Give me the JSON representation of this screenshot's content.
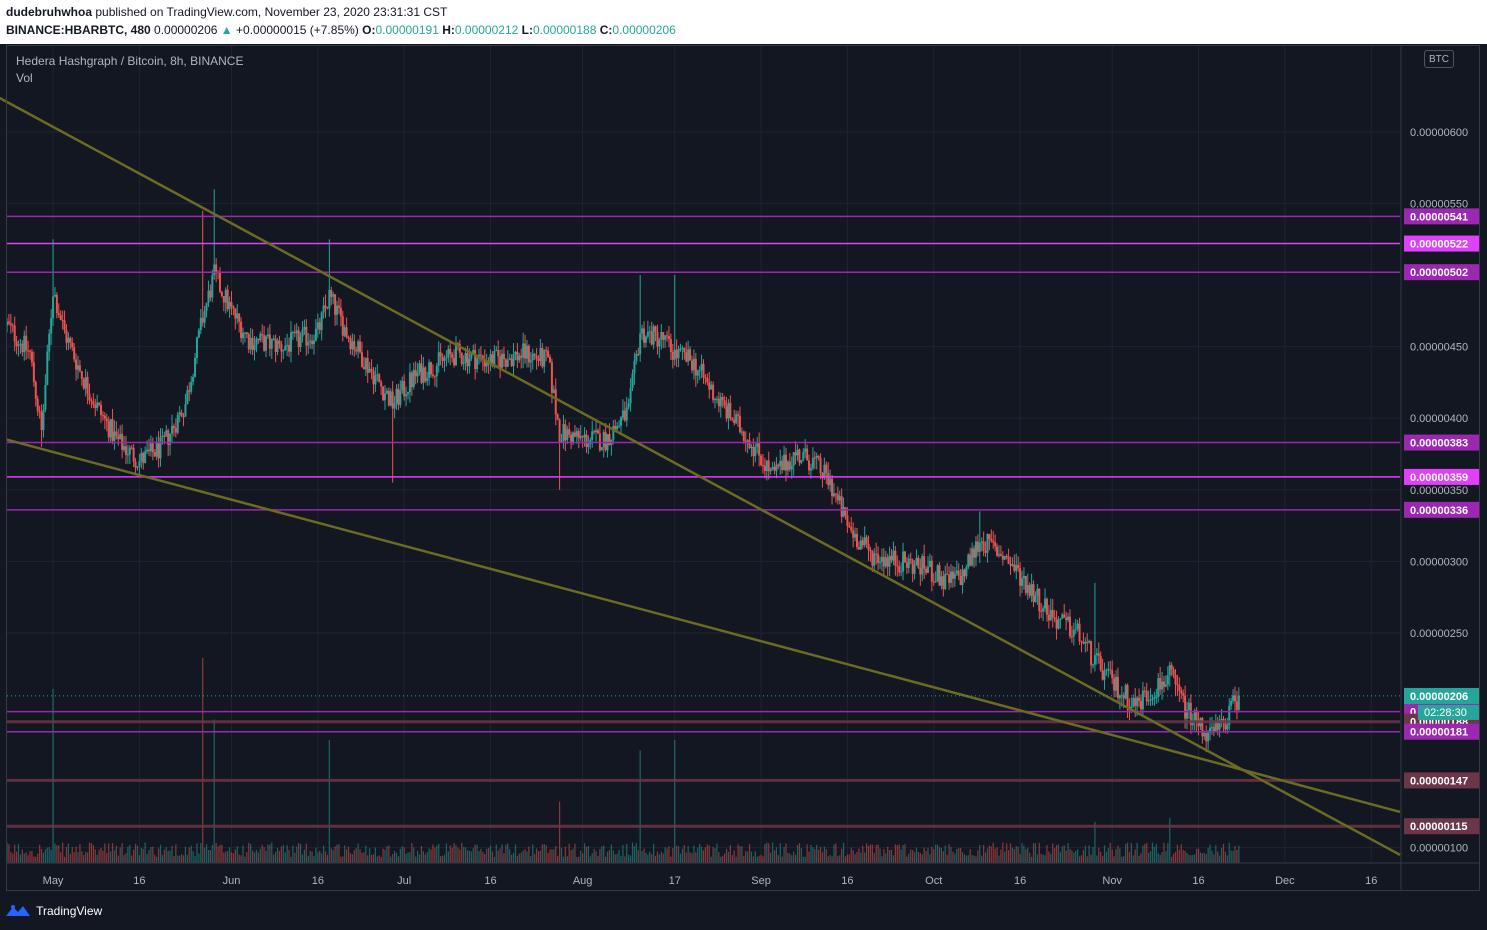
{
  "header": {
    "username": "dudebruhwhoa",
    "published_text": "published on TradingView.com, November 23, 2020 23:31:31 CST",
    "symbol": "BINANCE:HBARBTC, 480",
    "price": "0.00000206",
    "change_arrow": "▲",
    "change": "+0.00000015 (+7.85%)",
    "ohlc": [
      {
        "k": "O:",
        "v": "0.00000191"
      },
      {
        "k": "H:",
        "v": "0.00000212"
      },
      {
        "k": "L:",
        "v": "0.00000188"
      },
      {
        "k": "C:",
        "v": "0.00000206"
      }
    ]
  },
  "legend": {
    "title": "Hedera Hashgraph / Bitcoin, 8h, BINANCE",
    "volume_label": "Vol"
  },
  "currency_label": "BTC",
  "countdown": "02:28:30",
  "footer": {
    "brand": "TradingView"
  },
  "colors": {
    "background": "#131722",
    "grid": "#1f2430",
    "up": "#26a69a",
    "down": "#ef5350",
    "level_purple": "#9c27b0",
    "level_magenta": "#e040fb",
    "level_brown": "#6d3646",
    "trendline": "#6b6b24",
    "price_label_bg": "#26a69a"
  },
  "chart_data": {
    "type": "candlestick",
    "title": "Hedera Hashgraph / Bitcoin, 8h, BINANCE",
    "x_ticks": [
      "May",
      "16",
      "Jun",
      "16",
      "Jul",
      "16",
      "Aug",
      "17",
      "Sep",
      "16",
      "Oct",
      "16",
      "Nov",
      "16",
      "Dec",
      "16"
    ],
    "x_tick_dates": [
      "2020-05-01",
      "2020-05-16",
      "2020-06-01",
      "2020-06-16",
      "2020-07-01",
      "2020-07-16",
      "2020-08-01",
      "2020-08-17",
      "2020-09-01",
      "2020-09-16",
      "2020-10-01",
      "2020-10-16",
      "2020-11-01",
      "2020-11-16",
      "2020-12-01",
      "2020-12-16"
    ],
    "y_ticks": [
      "0.00000600",
      "0.00000550",
      "0.00000450",
      "0.00000400",
      "0.00000350",
      "0.00000300",
      "0.00000250",
      "0.00000100"
    ],
    "y_range": [
      9e-07,
      6.6e-06
    ],
    "x_range": [
      "2020-04-23",
      "2020-12-21"
    ],
    "price_path": [
      [
        "2020-04-23",
        4.65e-06
      ],
      [
        "2020-04-27",
        4.45e-06
      ],
      [
        "2020-04-29",
        3.9e-06
      ],
      [
        "2020-05-01",
        4.9e-06
      ],
      [
        "2020-05-03",
        4.6e-06
      ],
      [
        "2020-05-06",
        4.3e-06
      ],
      [
        "2020-05-09",
        4.05e-06
      ],
      [
        "2020-05-12",
        3.85e-06
      ],
      [
        "2020-05-16",
        3.7e-06
      ],
      [
        "2020-05-20",
        3.8e-06
      ],
      [
        "2020-05-24",
        4.1e-06
      ],
      [
        "2020-05-27",
        4.7e-06
      ],
      [
        "2020-05-29",
        5e-06
      ],
      [
        "2020-06-01",
        4.75e-06
      ],
      [
        "2020-06-04",
        4.55e-06
      ],
      [
        "2020-06-10",
        4.5e-06
      ],
      [
        "2020-06-16",
        4.6e-06
      ],
      [
        "2020-06-18",
        4.85e-06
      ],
      [
        "2020-06-21",
        4.6e-06
      ],
      [
        "2020-06-25",
        4.35e-06
      ],
      [
        "2020-06-29",
        4.1e-06
      ],
      [
        "2020-07-03",
        4.3e-06
      ],
      [
        "2020-07-10",
        4.45e-06
      ],
      [
        "2020-07-16",
        4.4e-06
      ],
      [
        "2020-07-22",
        4.45e-06
      ],
      [
        "2020-07-26",
        4.4e-06
      ],
      [
        "2020-07-28",
        3.9e-06
      ],
      [
        "2020-08-01",
        3.85e-06
      ],
      [
        "2020-08-05",
        3.85e-06
      ],
      [
        "2020-08-09",
        4.05e-06
      ],
      [
        "2020-08-11",
        4.6e-06
      ],
      [
        "2020-08-15",
        4.55e-06
      ],
      [
        "2020-08-17",
        4.45e-06
      ],
      [
        "2020-08-20",
        4.4e-06
      ],
      [
        "2020-08-25",
        4.1e-06
      ],
      [
        "2020-08-30",
        3.85e-06
      ],
      [
        "2020-09-03",
        3.6e-06
      ],
      [
        "2020-09-07",
        3.75e-06
      ],
      [
        "2020-09-10",
        3.7e-06
      ],
      [
        "2020-09-13",
        3.55e-06
      ],
      [
        "2020-09-16",
        3.25e-06
      ],
      [
        "2020-09-20",
        3.05e-06
      ],
      [
        "2020-09-25",
        3e-06
      ],
      [
        "2020-09-30",
        2.95e-06
      ],
      [
        "2020-10-03",
        2.85e-06
      ],
      [
        "2020-10-06",
        2.9e-06
      ],
      [
        "2020-10-09",
        3.15e-06
      ],
      [
        "2020-10-13",
        3.05e-06
      ],
      [
        "2020-10-18",
        2.8e-06
      ],
      [
        "2020-10-22",
        2.6e-06
      ],
      [
        "2020-10-26",
        2.5e-06
      ],
      [
        "2020-10-29",
        2.3e-06
      ],
      [
        "2020-11-01",
        2.15e-06
      ],
      [
        "2020-11-05",
        2e-06
      ],
      [
        "2020-11-08",
        2.1e-06
      ],
      [
        "2020-11-11",
        2.2e-06
      ],
      [
        "2020-11-14",
        1.95e-06
      ],
      [
        "2020-11-18",
        1.78e-06
      ],
      [
        "2020-11-20",
        1.85e-06
      ],
      [
        "2020-11-23",
        2.06e-06
      ]
    ],
    "wicks": [
      {
        "date": "2020-04-29",
        "low": 3.8e-06
      },
      {
        "date": "2020-05-01",
        "high": 5.25e-06
      },
      {
        "date": "2020-05-16",
        "low": 3.6e-06
      },
      {
        "date": "2020-05-27",
        "high": 5.45e-06
      },
      {
        "date": "2020-05-29",
        "high": 5.6e-06
      },
      {
        "date": "2020-06-18",
        "high": 5.25e-06
      },
      {
        "date": "2020-06-29",
        "low": 3.55e-06
      },
      {
        "date": "2020-07-28",
        "low": 3.5e-06
      },
      {
        "date": "2020-08-11",
        "high": 5e-06
      },
      {
        "date": "2020-08-17",
        "high": 5e-06
      },
      {
        "date": "2020-10-09",
        "high": 3.35e-06
      },
      {
        "date": "2020-10-29",
        "high": 2.85e-06
      },
      {
        "date": "2020-11-11",
        "high": 2.3e-06
      },
      {
        "date": "2020-11-18",
        "low": 1.75e-06
      },
      {
        "date": "2020-11-23",
        "high": 2.12e-06
      }
    ],
    "volume_spikes": [
      {
        "date": "2020-05-01",
        "value": 0.85
      },
      {
        "date": "2020-05-27",
        "value": 1.0
      },
      {
        "date": "2020-05-29",
        "value": 0.7
      },
      {
        "date": "2020-06-18",
        "value": 0.6
      },
      {
        "date": "2020-08-11",
        "value": 0.55
      },
      {
        "date": "2020-08-17",
        "value": 0.6
      },
      {
        "date": "2020-07-28",
        "value": 0.3
      },
      {
        "date": "2020-10-29",
        "value": 0.2
      },
      {
        "date": "2020-11-11",
        "value": 0.22
      }
    ],
    "levels": [
      {
        "label": "0.00000541",
        "value": 5.41e-06,
        "kind": "purple"
      },
      {
        "label": "0.00000522",
        "value": 5.22e-06,
        "kind": "magenta"
      },
      {
        "label": "0.00000502",
        "value": 5.02e-06,
        "kind": "purple"
      },
      {
        "label": "0.00000383",
        "value": 3.83e-06,
        "kind": "purple"
      },
      {
        "label": "0.00000359",
        "value": 3.59e-06,
        "kind": "magenta"
      },
      {
        "label": "0.00000336",
        "value": 3.36e-06,
        "kind": "purple"
      },
      {
        "label": "0.00000195",
        "value": 1.95e-06,
        "kind": "purple"
      },
      {
        "label": "0.00000188",
        "value": 1.88e-06,
        "kind": "brown"
      },
      {
        "label": "0.00000181",
        "value": 1.81e-06,
        "kind": "purple"
      },
      {
        "label": "0.00000147",
        "value": 1.47e-06,
        "kind": "brown"
      },
      {
        "label": "0.00000115",
        "value": 1.15e-06,
        "kind": "brown"
      }
    ],
    "trendlines": [
      {
        "from": [
          "2020-04-05",
          6.6e-06
        ],
        "to": [
          "2020-12-21",
          9.5e-07
        ]
      },
      {
        "from": [
          "2020-04-23",
          3.85e-06
        ],
        "to": [
          "2020-12-21",
          1.25e-06
        ]
      }
    ],
    "last_price": {
      "label": "0.00000206",
      "value": 2.06e-06
    }
  }
}
